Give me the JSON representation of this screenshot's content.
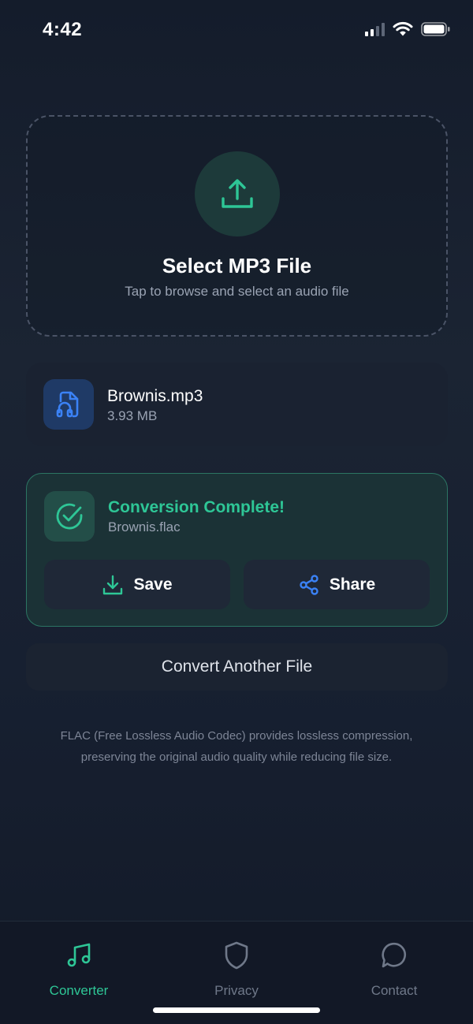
{
  "status_bar": {
    "time": "4:42"
  },
  "drop_zone": {
    "title": "Select MP3 File",
    "subtitle": "Tap to browse and select an audio file",
    "icon": "upload-icon"
  },
  "file_card": {
    "name": "Brownis.mp3",
    "size": "3.93 MB",
    "icon": "audio-file-icon"
  },
  "result": {
    "title": "Conversion Complete!",
    "file": "Brownis.flac",
    "icon": "check-circle-icon",
    "save_label": "Save",
    "share_label": "Share"
  },
  "convert_another_label": "Convert Another File",
  "info_text": "FLAC (Free Lossless Audio Codec) provides lossless compression, preserving the original audio quality while reducing file size.",
  "tabs": [
    {
      "label": "Converter",
      "icon": "music-note-icon",
      "active": true
    },
    {
      "label": "Privacy",
      "icon": "shield-icon",
      "active": false
    },
    {
      "label": "Contact",
      "icon": "chat-bubble-icon",
      "active": false
    }
  ],
  "colors": {
    "accent_green": "#2ec696",
    "accent_blue": "#3b82f6",
    "background": "#172031",
    "muted_text": "#9aa3b3"
  }
}
